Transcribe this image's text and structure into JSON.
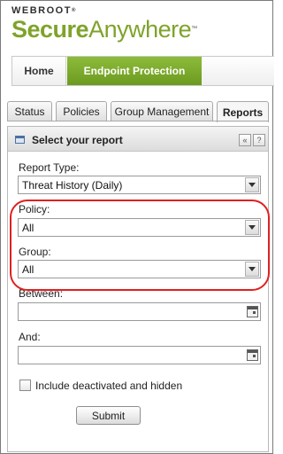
{
  "logo": {
    "brand": "WEBROOT",
    "brand_mark": "®",
    "product_bold": "Secure",
    "product_light": "Anywhere",
    "product_mark": "™"
  },
  "topnav": {
    "home_label": "Home",
    "endpoint_label": "Endpoint Protection",
    "accent": "#7aa82e"
  },
  "tabs": [
    {
      "label": "Status",
      "active": false
    },
    {
      "label": "Policies",
      "active": false
    },
    {
      "label": "Group Management",
      "active": false
    },
    {
      "label": "Reports",
      "active": true
    }
  ],
  "panel": {
    "title": "Select your report",
    "collapse_glyph": "«",
    "help_glyph": "?",
    "icon": "report-panel-icon"
  },
  "form": {
    "report_type_label": "Report Type:",
    "report_type_value": "Threat History (Daily)",
    "policy_label": "Policy:",
    "policy_value": "All",
    "group_label": "Group:",
    "group_value": "All",
    "between_label": "Between:",
    "between_value": "",
    "and_label": "And:",
    "and_value": "",
    "include_label": "Include deactivated and hidden",
    "include_checked": false,
    "submit_label": "Submit"
  },
  "annotation": {
    "color": "#e02020"
  }
}
